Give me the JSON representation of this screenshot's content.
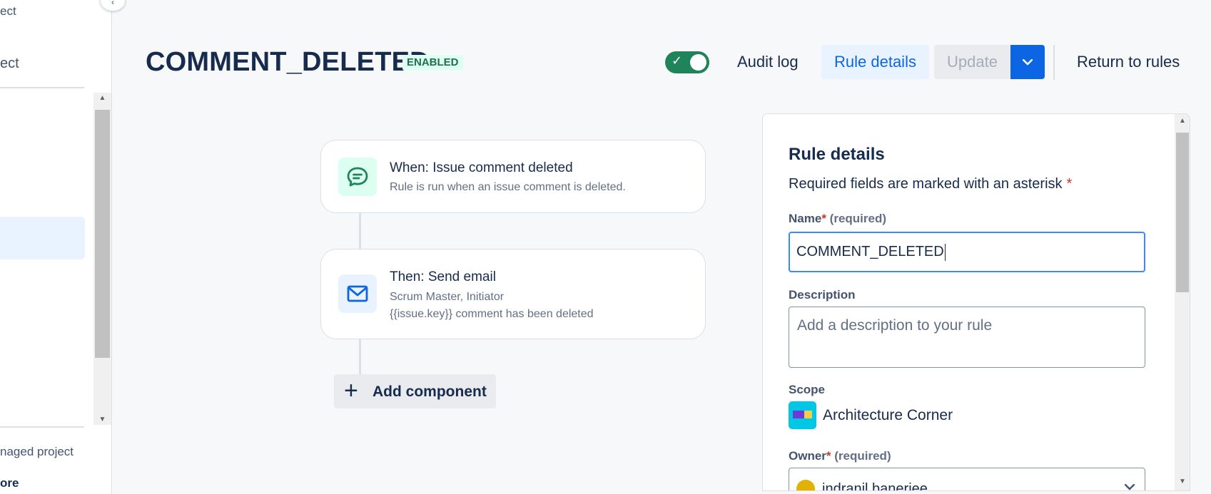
{
  "sidebar": {
    "top_partial": "ect",
    "project_partial": "ect",
    "managed_partial": "naged project",
    "more_partial": "ore",
    "collapse_glyph": "‹"
  },
  "header": {
    "title": "COMMENT_DELETED",
    "status": "ENABLED",
    "toggle_on": true,
    "audit_log": "Audit log",
    "rule_details": "Rule details",
    "update": "Update",
    "return_to_rules": "Return to rules"
  },
  "flow": {
    "trigger": {
      "title": "When: Issue comment deleted",
      "subtitle": "Rule is run when an issue comment is deleted.",
      "icon": "comment-icon",
      "icon_color": "#1f845a"
    },
    "action": {
      "title": "Then: Send email",
      "line1": "Scrum Master, Initiator",
      "line2": "{{issue.key}} comment has been deleted",
      "icon": "mail-icon",
      "icon_color": "#0c66e4"
    },
    "add_component": "Add component"
  },
  "panel": {
    "heading": "Rule details",
    "required_note": "Required fields are marked with an asterisk",
    "required_marker": "*",
    "name_label": "Name",
    "name_required": "(required)",
    "name_value": "COMMENT_DELETED",
    "description_label": "Description",
    "description_placeholder": "Add a description to your rule",
    "scope_label": "Scope",
    "scope_value": "Architecture Corner",
    "owner_label": "Owner",
    "owner_required": "(required)",
    "owner_value": "indranil banerjee"
  },
  "colors": {
    "accent": "#0c66e4",
    "enabled_bg": "#dcfff1",
    "enabled_text": "#216e4e",
    "toggle_on": "#1f845a"
  }
}
